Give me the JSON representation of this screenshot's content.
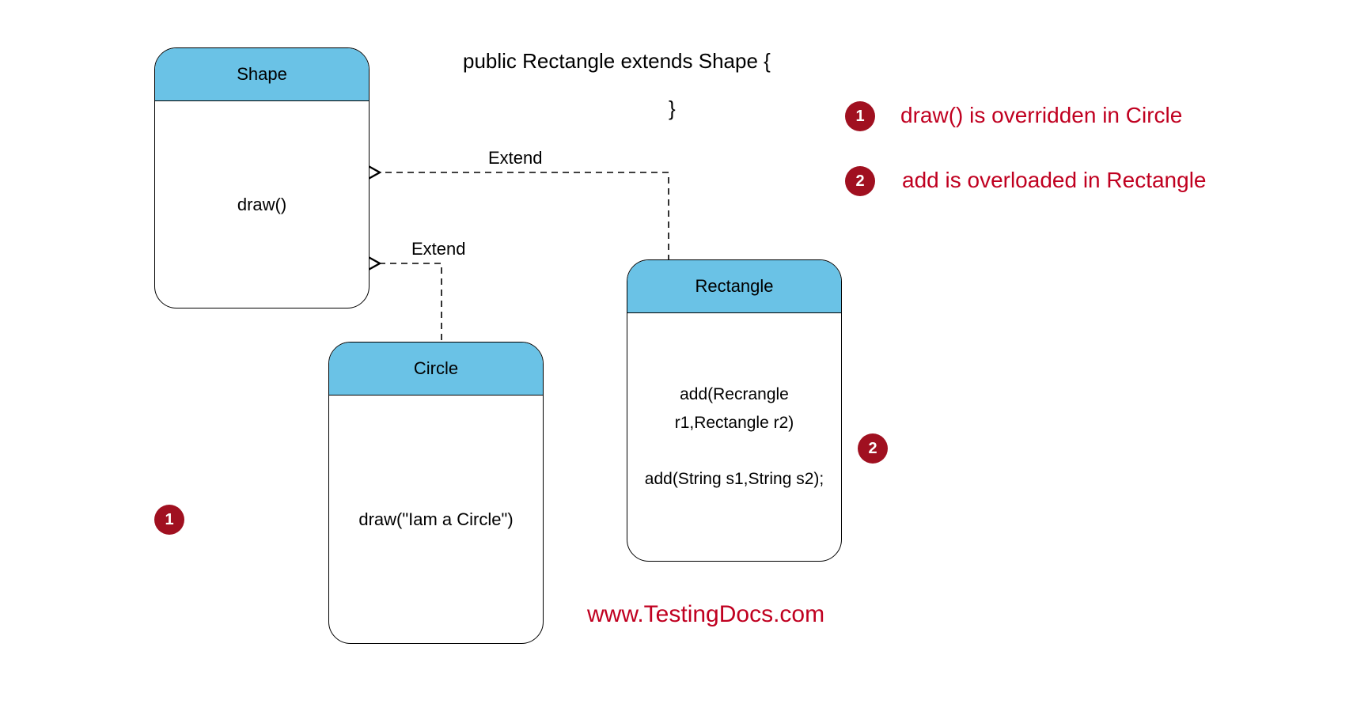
{
  "classes": {
    "shape": {
      "name": "Shape",
      "body": "draw()"
    },
    "circle": {
      "name": "Circle",
      "body": "draw(\"Iam a Circle\")"
    },
    "rectangle": {
      "name": "Rectangle",
      "body": "add(Recrangle r1,Rectangle r2)\n\nadd(String s1,String s2);"
    }
  },
  "code": {
    "line1": "public Rectangle extends Shape {",
    "line2": "}"
  },
  "labels": {
    "extend1": "Extend",
    "extend2": "Extend"
  },
  "badges": {
    "b1": "1",
    "b2": "2",
    "b3": "1",
    "b4": "2"
  },
  "notes": {
    "n1": "draw() is overridden in Circle",
    "n2": "add is overloaded in Rectangle"
  },
  "url": "www.TestingDocs.com"
}
